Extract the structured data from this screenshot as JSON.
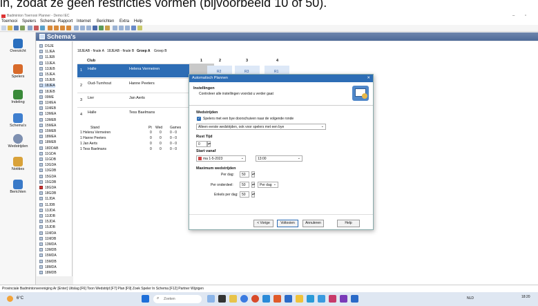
{
  "caption_text": "in, zodat ze geen restricties vormen (bijvoorbeeld 10 of 50).",
  "app": {
    "title": "Badminton Toernooi Planner - Demo IEC",
    "menu": [
      "Toernooi",
      "Spelers",
      "Schema",
      "Rapport",
      "Internet",
      "Berichten",
      "Extra",
      "Help"
    ]
  },
  "nav": [
    {
      "label": "Overzicht",
      "icon": "overview-icon",
      "color": "#2a6fbe"
    },
    {
      "label": "Spelers",
      "icon": "players-icon",
      "color": "#d86a2a"
    },
    {
      "label": "Indeling",
      "icon": "draw-icon",
      "color": "#3a8a3a"
    },
    {
      "label": "Schema's",
      "icon": "schedule-icon",
      "color": "#3f7fcf"
    },
    {
      "label": "Wedstrijden",
      "icon": "matches-icon",
      "color": "#7d8fb0"
    },
    {
      "label": "Notities",
      "icon": "notes-icon",
      "color": "#d9a23a"
    },
    {
      "label": "Berichten",
      "icon": "messages-icon",
      "color": "#3a7ac8"
    }
  ],
  "header_title": "Schema's",
  "tree": [
    "DSJE",
    "11JEA",
    "11JEB",
    "13JEA",
    "13JEB",
    "15JEA",
    "15JEB",
    "18JEA",
    "18JEB",
    "09ME",
    "11MEA",
    "11MEB",
    "13MEA",
    "13MEB",
    "15MEA",
    "15MEB",
    "18MEA",
    "18MEB",
    "18DDAB",
    "11GDA",
    "11GDB",
    "13GDA",
    "13GDB",
    "15GDA",
    "15GDB",
    "18GDA",
    "18GDB",
    "11JDA",
    "11JDB",
    "13JDA",
    "13JDB",
    "15JDA",
    "15JDB",
    "11MDA",
    "11MDB",
    "13MDA",
    "13MDB",
    "15MDA",
    "15MDB",
    "18MDA",
    "18MDB"
  ],
  "tree_selected": 7,
  "tree_red": 25,
  "tabs": [
    "18JEAB - finale A",
    "18JEAB - finale B",
    "Groep A",
    "Groep B"
  ],
  "grid": {
    "club_header": "Club",
    "col_headers": [
      "1",
      "2",
      "3",
      "4"
    ],
    "rows": [
      {
        "num": "1",
        "club": "Halle",
        "player": "Helena Vermeiren"
      },
      {
        "num": "2",
        "club": "Oud-Turnhout",
        "player": "Hanne Peeters"
      },
      {
        "num": "3",
        "club": "Lier",
        "player": "Jan Aerts"
      },
      {
        "num": "4",
        "club": "Halle",
        "player": "Tess Baelmans"
      }
    ],
    "row1_matches": [
      "R2",
      "R3",
      "R1"
    ]
  },
  "standings": {
    "headers": [
      "Stand",
      "Pt",
      "Wed",
      "Games"
    ],
    "rows": [
      {
        "name": "1 Helena Vermeiren",
        "pt": "0",
        "wed": "0",
        "games": "0 - 0"
      },
      {
        "name": "1 Hanne Peeters",
        "pt": "0",
        "wed": "0",
        "games": "0 - 0"
      },
      {
        "name": "1 Jan Aerts",
        "pt": "0",
        "wed": "0",
        "games": "0 - 0"
      },
      {
        "name": "1 Tess Baelmans",
        "pt": "0",
        "wed": "0",
        "games": "0 - 0"
      }
    ]
  },
  "dialog": {
    "title": "Automatisch Plannen",
    "close": "✕",
    "heading": "Instellingen",
    "subheading": "Controleer alle instellingen voordat u verder gaat",
    "wedstrijden_label": "Wedstrijden",
    "bye_checkbox": "Spelers met een bye doorschuiven naar de volgende ronde",
    "bye_checked": true,
    "bye_option": "Alleen eerste wedstrijden, ook voor spelers met een bye",
    "rust_label": "Rust Tijd",
    "rust_value": "0",
    "start_label": "Start vanaf",
    "start_date": "ma 1-5-2023",
    "start_time": "13:00",
    "max_label": "Maximum wedstrijden",
    "per_dag_label": "Per dag:",
    "per_dag_value": "50",
    "per_onderdeel_label": "Per onderdeel:",
    "per_onderdeel_value": "50",
    "per_onderdeel_unit": "Per dag",
    "enkels_label": "Enkels per dag:",
    "enkels_value": "50",
    "buttons": {
      "back": "< Vorige",
      "finish": "Voltooien",
      "cancel": "Annuleren",
      "help": "Help"
    }
  },
  "statusbar": "Provinciale Badmintonvereniging Ar   [Enter] Uitslag [F6] Toon Wedstrijd [F7] Plan [F9] Zoek Speler In Schema [F12] Partner Wijzigen",
  "taskbar": {
    "weather": "6°C",
    "search": "Zoeken",
    "lang": "NLD",
    "time": "18:20"
  }
}
